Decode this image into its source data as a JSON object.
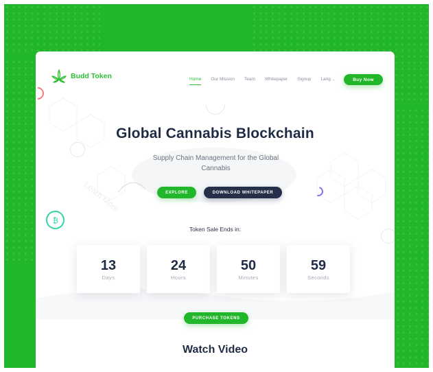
{
  "brand": {
    "name": "Budd Token",
    "color": "#2fbf36",
    "icon": "cannabis-leaf-icon"
  },
  "nav": {
    "items": [
      {
        "label": "Home",
        "active": true
      },
      {
        "label": "Our Mission",
        "active": false
      },
      {
        "label": "Team",
        "active": false
      },
      {
        "label": "Whitepaper",
        "active": false
      },
      {
        "label": "Signup",
        "active": false
      },
      {
        "label": "Lang",
        "active": false
      }
    ],
    "buy_label": "Buy Now"
  },
  "hero": {
    "title": "Global Cannabis Blockchain",
    "subtitle": "Supply Chain Management for the Global Cannabis",
    "explore_label": "EXPLORE",
    "whitepaper_label": "DOWNLOAD WHITEPAPER"
  },
  "sale": {
    "label": "Token Sale Ends in:",
    "countdown": [
      {
        "value": "13",
        "unit": "Days"
      },
      {
        "value": "24",
        "unit": "Hours"
      },
      {
        "value": "50",
        "unit": "Minutes"
      },
      {
        "value": "59",
        "unit": "Seconds"
      }
    ],
    "purchase_label": "PURCHASE TOKENS"
  },
  "video": {
    "title": "Watch Video"
  },
  "colors": {
    "accent": "#22b72a",
    "dark": "#243049",
    "background": "#22b72a"
  }
}
